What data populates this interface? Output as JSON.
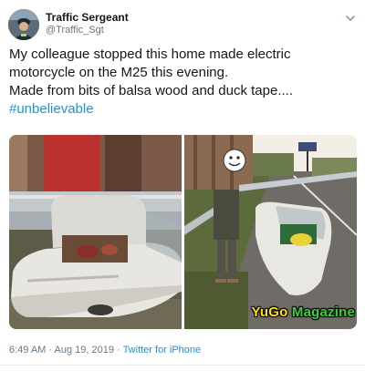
{
  "author": {
    "display_name": "Traffic Sergeant",
    "handle": "@Traffic_Sgt",
    "avatar_icon": "police-officer-avatar"
  },
  "menu_icon": "chevron-down-icon",
  "tweet": {
    "line1": "My colleague stopped this home made electric",
    "line2": "motorcycle on the M25 this evening.",
    "line3": "Made from bits of balsa wood and duck tape....",
    "hashtag": "#unbelievable"
  },
  "watermark": {
    "part1": "YuGo",
    "part2": "Magazine",
    "color1": "#ffe400",
    "color2": "#3ecf3e"
  },
  "meta": {
    "time": "6:49 AM",
    "separator1": " · ",
    "date": "Aug 19, 2019",
    "separator2": " · ",
    "source": "Twitter for iPhone"
  },
  "colors": {
    "link": "#1b95e0",
    "muted": "#657786",
    "text": "#14171a"
  }
}
